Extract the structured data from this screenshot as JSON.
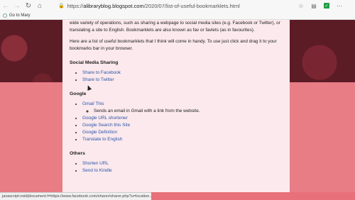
{
  "toolbar": {
    "url_prefix": "https://",
    "url_host": "alibraryblog.blogspot.com",
    "url_path": "/2020/07/list-of-useful-bookmarklets.html"
  },
  "bookmarks": [
    {
      "label": "Go to Mary"
    }
  ],
  "article": {
    "intro": "wide variety of operations, such as sharing a webpage to social media sites (e.g. Facebook or Twitter), or translating a site to English. Bookmarklets are also known as fav or favlets (as in favourites).",
    "para2": "Here are a list of useful bookmarklets that I think will come in handy. To use just click and drag it to your bookmarks bar in your browser.",
    "sections": [
      {
        "heading": "Social Media Sharing",
        "links": [
          "Share to Facebook",
          "Share to Twitter"
        ]
      },
      {
        "heading": "Google",
        "gmail": "Gmail This",
        "gmail_note": "Sends an email in Gmail with a link from the website.",
        "links": [
          "Google URL shortener",
          "Google Search this Site",
          "Google Definition",
          "Translate to English"
        ]
      },
      {
        "heading": "Others",
        "links": [
          "Shorten URL",
          "Send to Kindle"
        ]
      }
    ]
  },
  "status_bar": {
    "text": "javascript:void(document.f=https://www.facebook.com/sharer/sharer.php?u=location..."
  },
  "icons": [
    "back-icon",
    "forward-icon",
    "refresh-icon",
    "home-icon",
    "lock-icon",
    "star-icon",
    "collections-icon",
    "extension-icon",
    "menu-icon",
    "globe-icon"
  ]
}
